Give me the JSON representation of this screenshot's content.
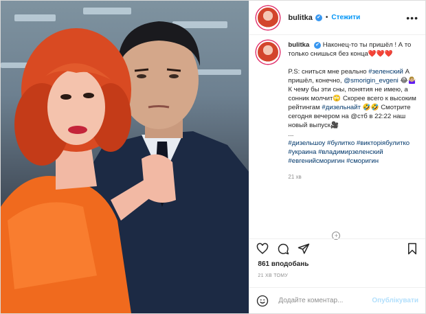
{
  "post": {
    "username": "bulitka",
    "verified_mark": "✔",
    "follow_label": "Стежити",
    "caption": {
      "title_line": "Наконец-то ты пришёл ! А то только снишься без конца❤️❤️❤️",
      "ps_line": "P.S: сниться мне реально",
      "tag_zelensky": "#зеленский",
      "line_came": "А пришёл, конечно,",
      "mention": "@smorigin_evgeni",
      "line_dreams": "😂🤷🏼‍♀️ К чему бы эти сны, понятия не имею, а сонник молчит🙄 Скорее всего к высоким рейтингам",
      "tag_dizel": "#дизельнайт",
      "line_watch": "🤣🤣 Смотрите сегодня вечером на @стб в 22:22 наш новый выпуск🎥",
      "ellipsis": "...",
      "hashtags": "#дизельшоу #булитко #викторiябулитко #украина #владимирзеленский #евгенийсморигин #сморигин",
      "time": "21 хв"
    },
    "likes": "861 вподобань",
    "timestamp": "21 ХВ ТОМУ",
    "comment_placeholder": "Додайте коментар...",
    "publish_label": "Опублікувати"
  },
  "icons": {
    "more": "more-options-icon",
    "like": "heart-icon",
    "comment": "comment-icon",
    "share": "share-icon",
    "save": "bookmark-icon",
    "emoji": "emoji-icon",
    "load_more": "load-more-comments-icon"
  },
  "colors": {
    "link": "#0095f6",
    "hashtag": "#00376b",
    "muted": "#8e8e8e",
    "publish_disabled": "#b2dffc"
  }
}
